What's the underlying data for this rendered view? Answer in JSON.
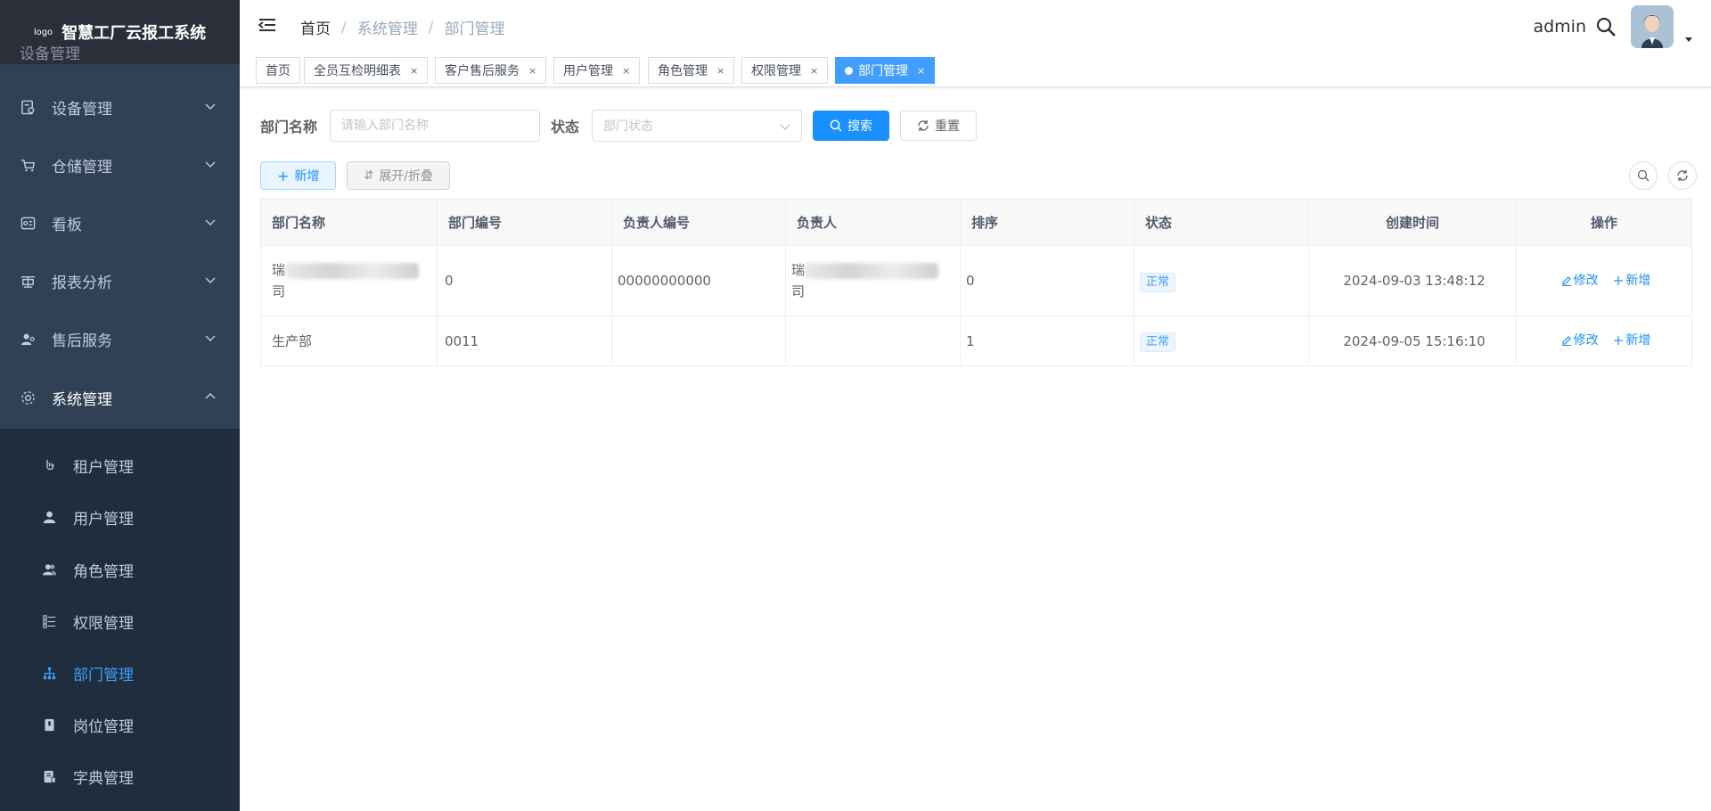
{
  "brand": {
    "logo": "logo",
    "name": "智慧工厂云报工系统",
    "hidden_item": "设备管理"
  },
  "sidebar": {
    "items": [
      {
        "label": "设备管理",
        "icon": "device-icon"
      },
      {
        "label": "仓储管理",
        "icon": "cart-icon"
      },
      {
        "label": "看板",
        "icon": "dashboard-icon"
      },
      {
        "label": "报表分析",
        "icon": "report-icon"
      },
      {
        "label": "售后服务",
        "icon": "service-icon"
      },
      {
        "label": "系统管理",
        "icon": "gear-icon",
        "expanded": true
      }
    ],
    "sub_items": [
      {
        "label": "租户管理",
        "icon": "tenant-icon"
      },
      {
        "label": "用户管理",
        "icon": "user-icon"
      },
      {
        "label": "角色管理",
        "icon": "role-icon"
      },
      {
        "label": "权限管理",
        "icon": "permission-icon"
      },
      {
        "label": "部门管理",
        "icon": "tree-icon",
        "active": true
      },
      {
        "label": "岗位管理",
        "icon": "post-icon"
      },
      {
        "label": "字典管理",
        "icon": "dict-icon"
      }
    ]
  },
  "navbar": {
    "breadcrumb": [
      "首页",
      "系统管理",
      "部门管理"
    ],
    "breadcrumb_sep": "/",
    "user": "admin"
  },
  "tags": [
    {
      "label": "首页"
    },
    {
      "label": "全员互检明细表",
      "close": "×"
    },
    {
      "label": "客户售后服务",
      "close": "×"
    },
    {
      "label": "用户管理",
      "close": "×"
    },
    {
      "label": "角色管理",
      "close": "×"
    },
    {
      "label": "权限管理",
      "close": "×"
    },
    {
      "label": "部门管理",
      "close": "×",
      "active": true
    }
  ],
  "search": {
    "dept_label": "部门名称",
    "dept_placeholder": "请输入部门名称",
    "status_label": "状态",
    "status_placeholder": "部门状态",
    "search_btn": "搜索",
    "reset_btn": "重置"
  },
  "toolbar": {
    "add": "新增",
    "toggle": "展开/折叠"
  },
  "table": {
    "headers": [
      "部门名称",
      "部门编号",
      "负责人编号",
      "负责人",
      "排序",
      "状态",
      "创建时间",
      "操作"
    ],
    "rows": [
      {
        "name_start": "瑞",
        "name_end": "司",
        "code": "0",
        "leader_code": "00000000000",
        "leader_start": "瑞",
        "leader_end": "司",
        "sort": "0",
        "status": "正常",
        "created": "2024-09-03 13:48:12",
        "edit": "修改",
        "add": "新增"
      },
      {
        "name": "生产部",
        "code": "0011",
        "leader_code": "",
        "leader": "",
        "sort": "1",
        "status": "正常",
        "created": "2024-09-05 15:16:10",
        "edit": "修改",
        "add": "新增"
      }
    ]
  },
  "colors": {
    "sidebar_bg": "#304156",
    "submenu_bg": "#1f2d3d",
    "primary": "#1890ff",
    "active_menu": "#409eff"
  }
}
